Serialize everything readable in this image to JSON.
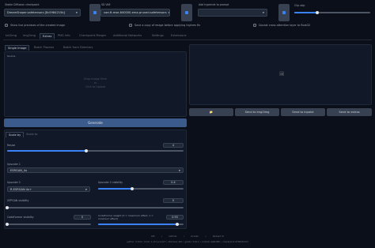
{
  "top": {
    "checkpoint_label": "Stable Diffusion checkpoint",
    "checkpoint_value": "DreamShaper.safetensors [8c5984215b]",
    "vae_label": "SD VAE",
    "vae_value": "vae-ft-mse-840000-ema-pruned.safetensors",
    "hypernet_label": "Add hypernet to prompt",
    "hypernet_value": "",
    "clip_label": "Clip skip",
    "clip_value": 0.3
  },
  "options": {
    "live_preview": "Show live previews of the created image",
    "save_copy": "Save a copy of image before applying highres fix",
    "upcast": "Upcast cross attention layer to float32"
  },
  "tabs": [
    "txt2img",
    "img2img",
    "Extras",
    "PNG Info",
    "Checkpoint Merger",
    "Additional Networks",
    "Settings",
    "Extensions"
  ],
  "subtabs": [
    "Single Image",
    "Batch Process",
    "Batch from Directory"
  ],
  "source": {
    "drop_line1": "Drop Image Here",
    "drop_line2": "- or -",
    "drop_line3": "Click to Upload"
  },
  "generate_label": "Generate",
  "output_icon_glyph": "🖼",
  "actions": {
    "folder_glyph": "📁",
    "send_img2img": "Send to img2img",
    "send_inpaint": "Send to inpaint",
    "send_extras": "Send to extras"
  },
  "scale": {
    "tab_scale_by": "Scale by",
    "tab_scale_to": "Scale to",
    "resize_label": "Resize",
    "resize_value": "4",
    "resize_fraction": 0.45,
    "upscaler1_label": "Upscaler 1",
    "upscaler1_value": "ESRGAN_4x",
    "upscaler2_label": "Upscaler 2",
    "upscaler2_value": "R-ESRGAN 4x+",
    "visibility_label": "Upscaler 2 visibility",
    "visibility_value": "0.4",
    "visibility_fraction": 0.4,
    "gfpgan_label": "GFPGAN visibility",
    "gfpgan_value": "0",
    "codeformer_vis_label": "CodeFormer visibility",
    "codeformer_vis_value": "0",
    "codeformer_weight_label": "CodeFormer weight (0 = maximum effect, 1 = minimum effect)",
    "codeformer_weight_value": "0.93",
    "codeformer_weight_fraction": 0.93
  },
  "footer": {
    "links": [
      "API",
      "Github",
      "Gradio",
      "Reload UI"
    ],
    "version": "python: 3.10.6  •  torch: 1.13.1+cu117  •  xformers: N/A  •  gradio: 3.16.2  •  commit: ea9bd9fc  •  checkpoint: 879db523c3"
  },
  "colors": {
    "background": "#0b0f19",
    "accent": "#3b82f6",
    "generate": "#3b5b8c"
  }
}
